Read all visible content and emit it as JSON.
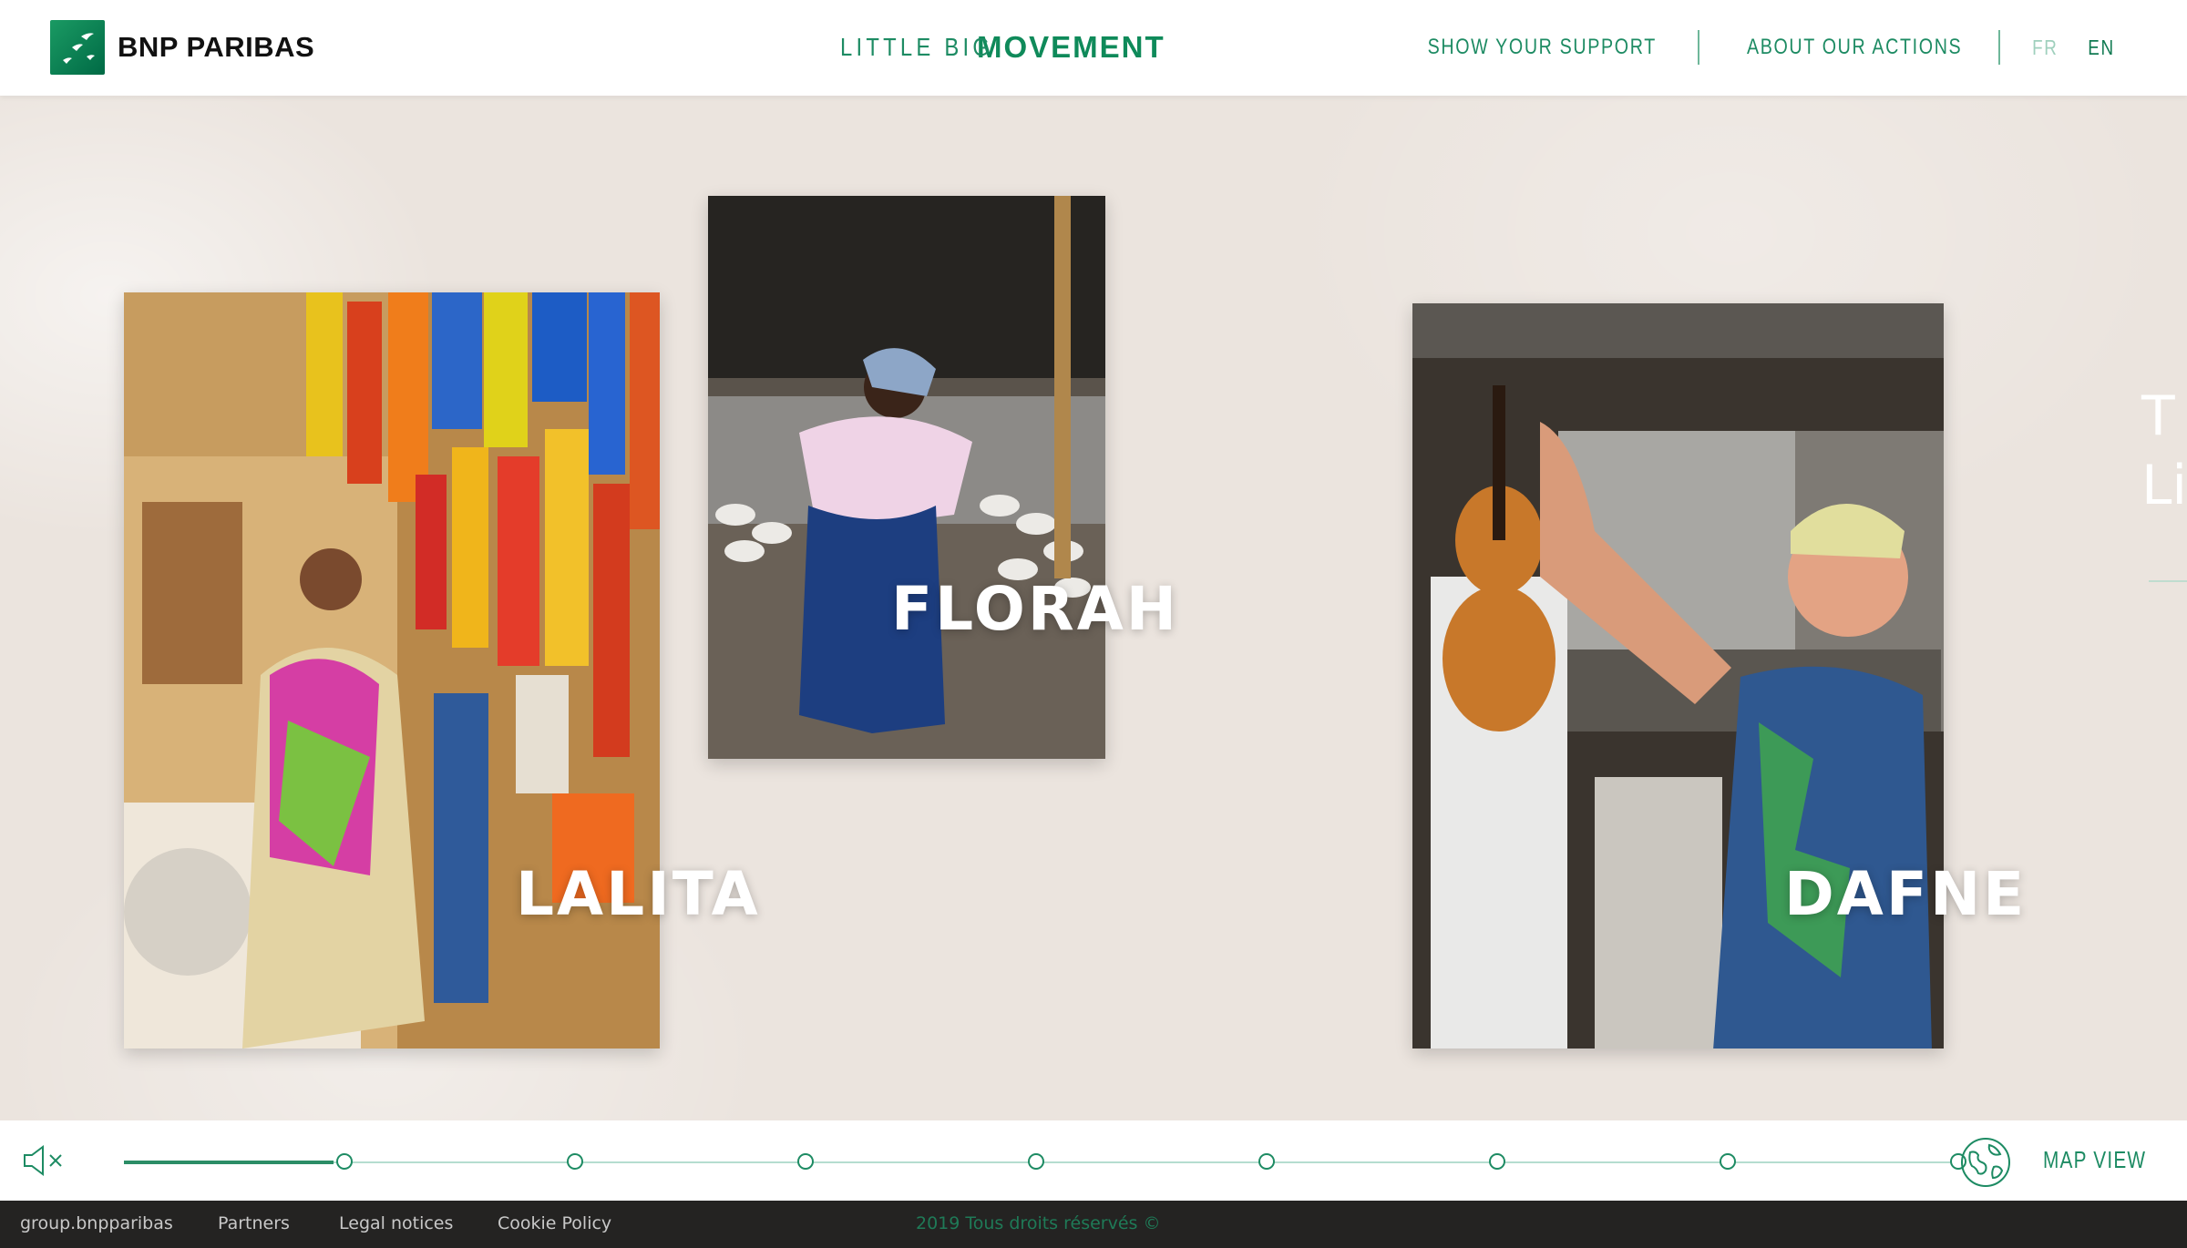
{
  "header": {
    "brand_name": "BNP PARIBAS",
    "title_light": "LITTLE BIG",
    "title_bold": "MOVEMENT",
    "nav": {
      "show_support": "SHOW YOUR SUPPORT",
      "about_actions": "ABOUT OUR ACTIONS"
    },
    "languages": {
      "fr": "FR",
      "en": "EN",
      "active": "EN"
    }
  },
  "portraits": [
    {
      "name": "LALITA"
    },
    {
      "name": "FLORAH"
    },
    {
      "name": "DAFNE"
    }
  ],
  "next_peek": {
    "line1": "T",
    "line2": "Li"
  },
  "timeline": {
    "mute_icon": "speaker-muted-icon",
    "progress": 0.05,
    "stops": 8,
    "map_icon": "globe-icon",
    "map_label": "MAP VIEW"
  },
  "footer": {
    "links": [
      "group.bnpparibas",
      "Partners",
      "Legal notices",
      "Cookie Policy"
    ],
    "copyright": "2019 Tous droits réservés ©"
  },
  "colors": {
    "brand_green": "#1d8b63",
    "accent_dark_green": "#117a52",
    "stage_bg": "#ebe4de",
    "footer_bg": "#242322"
  }
}
